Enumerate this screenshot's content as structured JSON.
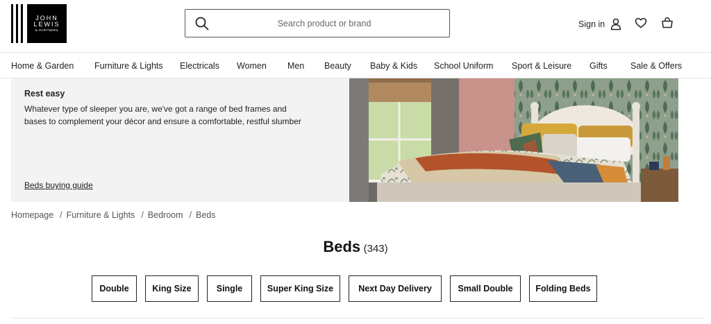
{
  "header": {
    "logo": {
      "line1": "JOHN",
      "line2": "LEWIS",
      "line3": "& PARTNERS"
    },
    "search": {
      "placeholder": "Search product or brand",
      "icon": "search-icon"
    },
    "signin_label": "Sign in",
    "icons": [
      "person-icon",
      "heart-icon",
      "basket-icon"
    ]
  },
  "nav": {
    "items": [
      {
        "label": "Home & Garden"
      },
      {
        "label": "Furniture & Lights"
      },
      {
        "label": "Electricals"
      },
      {
        "label": "Women"
      },
      {
        "label": "Men"
      },
      {
        "label": "Beauty"
      },
      {
        "label": "Baby & Kids"
      },
      {
        "label": "School Uniform"
      },
      {
        "label": "Sport & Leisure"
      },
      {
        "label": "Gifts"
      },
      {
        "label": "Sale & Offers"
      }
    ]
  },
  "hero": {
    "title": "Rest easy",
    "description": "Whatever type of sleeper you are, we've got a range of bed frames and bases to complement your décor and ensure a comfortable, restful slumber",
    "link": "Beds buying guide"
  },
  "breadcrumb": {
    "items": [
      {
        "label": "Homepage"
      },
      {
        "label": "Furniture & Lights"
      },
      {
        "label": "Bedroom"
      },
      {
        "label": "Beds"
      }
    ],
    "separator": "/"
  },
  "page": {
    "title": "Beds",
    "count": "(343)"
  },
  "filters": {
    "chips": [
      {
        "label": "Double"
      },
      {
        "label": "King Size"
      },
      {
        "label": "Single"
      },
      {
        "label": "Super King Size"
      },
      {
        "label": "Next Day Delivery"
      },
      {
        "label": "Small Double"
      },
      {
        "label": "Folding Beds"
      }
    ]
  },
  "colors": {
    "brand": "#000000",
    "text": "#222222",
    "hero_bg": "#f3f3f3",
    "divider": "#e2e2e2"
  }
}
